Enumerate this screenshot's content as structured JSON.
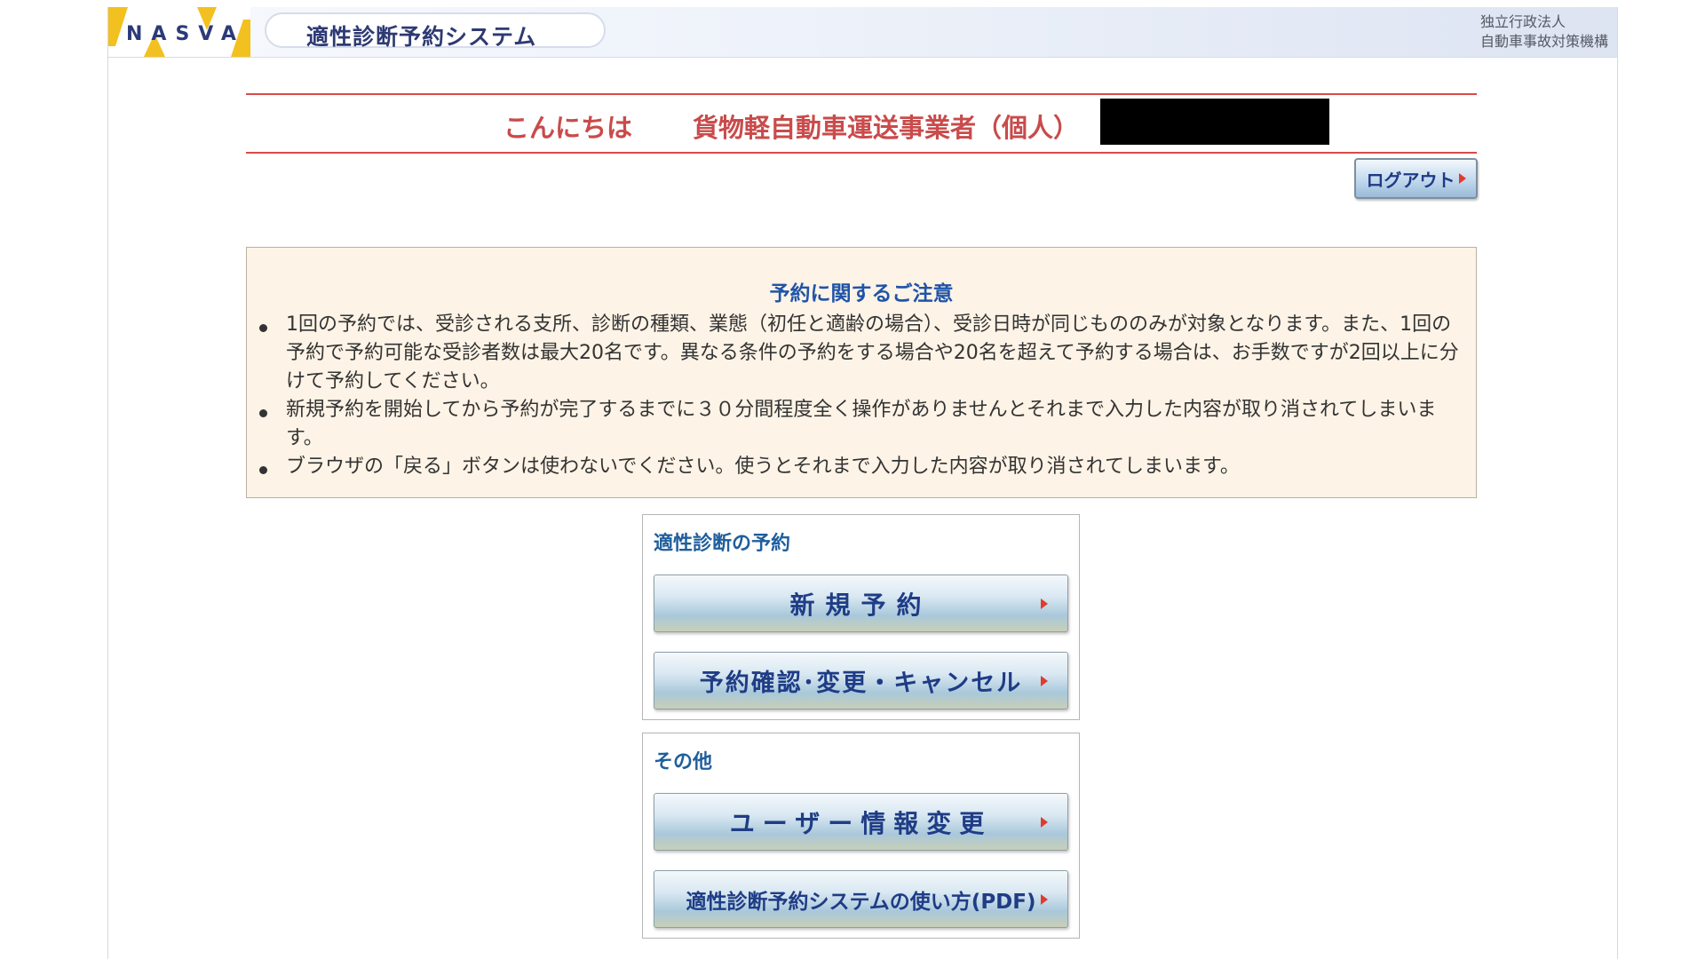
{
  "header": {
    "logo_text": "NASVA",
    "system_title": "適性診断予約システム",
    "org_line1": "独立行政法人",
    "org_line2": "自動車事故対策機構"
  },
  "greeting": {
    "hello": "こんにちは",
    "user_category": "貨物軽自動車運送事業者（個人）"
  },
  "logout": {
    "label": "ログアウト"
  },
  "notice": {
    "title": "予約に関するご注意",
    "items": [
      "1回の予約では、受診される支所、診断の種類、業態（初任と適齢の場合）、受診日時が同じもののみが対象となります。また、1回の予約で予約可能な受診者数は最大20名です。異なる条件の予約をする場合や20名を超えて予約する場合は、お手数ですが2回以上に分けて予約してください。",
      "新規予約を開始してから予約が完了するまでに３０分間程度全く操作がありませんとそれまで入力した内容が取り消されてしまいます。",
      "ブラウザの「戻る」ボタンは使わないでください。使うとそれまで入力した内容が取り消されてしまいます。"
    ]
  },
  "reservation_menu": {
    "heading": "適性診断の予約",
    "new_label": "新規予約",
    "manage_label": "予約確認･変更・キャンセル"
  },
  "other_menu": {
    "heading": "その他",
    "user_info_label": "ユーザー情報変更",
    "manual_label": "適性診断予約システムの使い方(PDF)"
  },
  "colors": {
    "accent_red": "#c94b4b",
    "link_blue": "#1f54a8",
    "notice_bg": "#fdf3e6"
  }
}
